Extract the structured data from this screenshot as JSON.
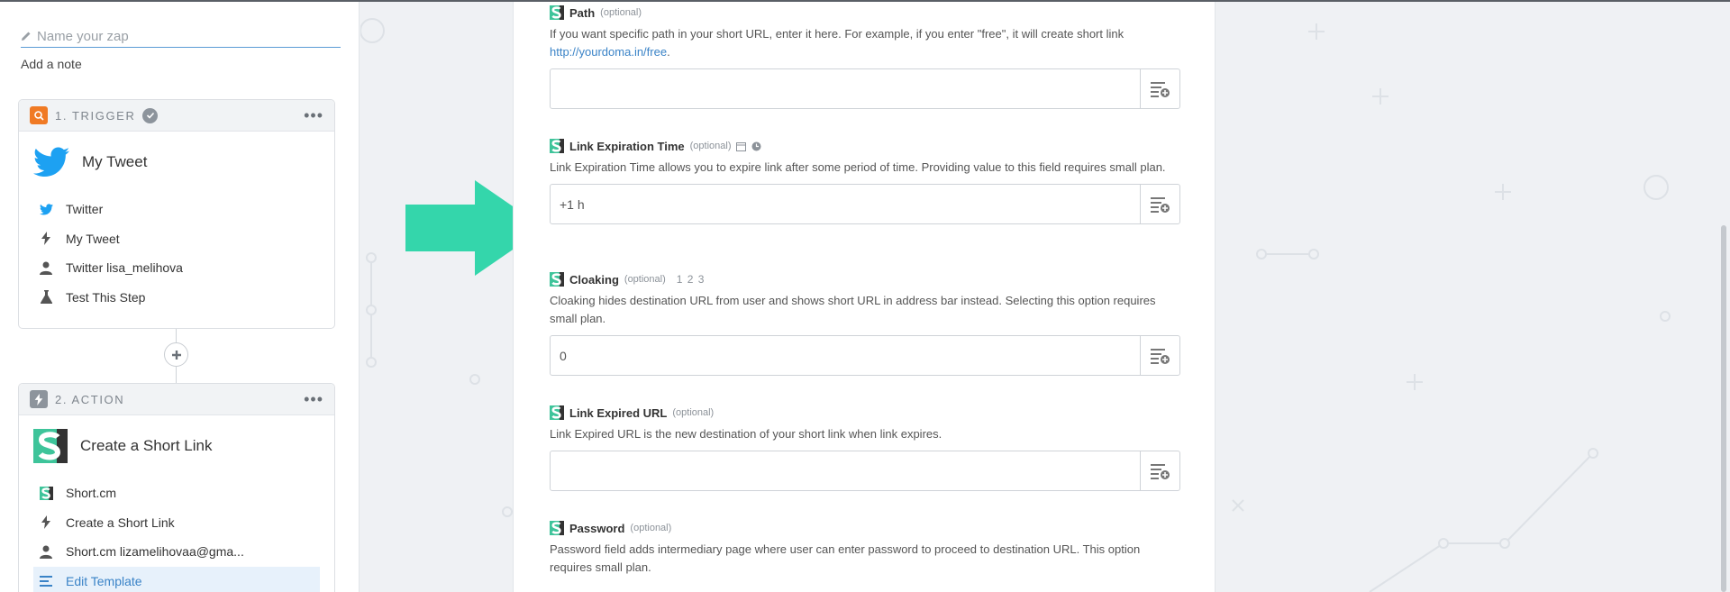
{
  "sidebar": {
    "zap_name_placeholder": "Name your zap",
    "add_note": "Add a note",
    "trigger": {
      "title": "1. TRIGGER",
      "app_name": "My Tweet",
      "items": [
        "Twitter",
        "My Tweet",
        "Twitter lisa_melihova",
        "Test This Step"
      ]
    },
    "action": {
      "title": "2. ACTION",
      "app_name": "Create a Short Link",
      "items": [
        "Short.cm",
        "Create a Short Link",
        "Short.cm lizamelihovaa@gma...",
        "Edit Template"
      ]
    }
  },
  "form": {
    "path": {
      "label": "Path",
      "optional": "(optional)",
      "desc": "If you want specific path in your short URL, enter it here. For example, if you enter \"free\", it will create short link",
      "link": "http://yourdoma.in/free",
      "value": ""
    },
    "expiration": {
      "label": "Link Expiration Time",
      "optional": "(optional)",
      "desc": "Link Expiration Time allows you to expire link after some period of time. Providing value to this field requires small plan.",
      "value": "+1 h"
    },
    "cloaking": {
      "label": "Cloaking",
      "optional": "(optional)",
      "extra": "1 2 3",
      "desc": "Cloaking hides destination URL from user and shows short URL in address bar instead. Selecting this option requires small plan.",
      "value": "0"
    },
    "expired_url": {
      "label": "Link Expired URL",
      "optional": "(optional)",
      "desc": "Link Expired URL is the new destination of your short link when link expires.",
      "value": ""
    },
    "password": {
      "label": "Password",
      "optional": "(optional)",
      "desc": "Password field adds intermediary page where user can enter password to proceed to destination URL. This option requires small plan."
    }
  },
  "colors": {
    "arrow": "#34d6ab",
    "shortcm_green": "#3ec49a",
    "twitter_blue": "#1da1f2",
    "link_blue": "#3a83c7"
  }
}
